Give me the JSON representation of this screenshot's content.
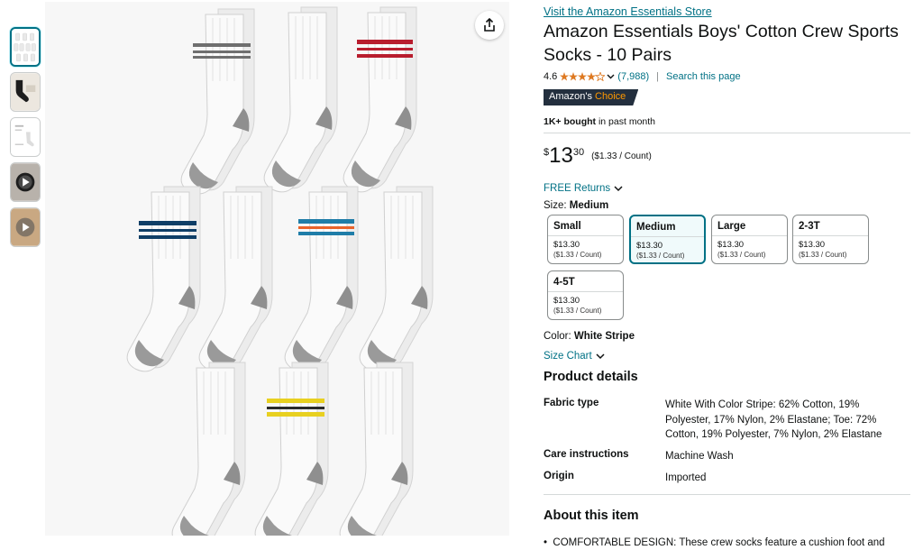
{
  "store_link": "Visit the Amazon Essentials Store",
  "title": "Amazon Essentials Boys' Cotton Crew Sports Socks - 10 Pairs",
  "rating": {
    "value": "4.6",
    "stars": 4.6,
    "count": "(7,988)",
    "search_page": "Search this page"
  },
  "badge": {
    "prefix": "Amazon's",
    "suffix": "Choice"
  },
  "bought": {
    "bold": "1K+ bought",
    "rest": "in past month"
  },
  "price": {
    "symbol": "$",
    "whole": "13",
    "fraction": "30",
    "unit": "($1.33 / Count)"
  },
  "returns": "FREE Returns",
  "size": {
    "label": "Size:",
    "selected": "Medium"
  },
  "sizes": [
    {
      "name": "Small",
      "price": "$13.30",
      "unit": "($1.33 / Count)"
    },
    {
      "name": "Medium",
      "price": "$13.30",
      "unit": "($1.33 / Count)"
    },
    {
      "name": "Large",
      "price": "$13.30",
      "unit": "($1.33 / Count)"
    },
    {
      "name": "2-3T",
      "price": "$13.30",
      "unit": "($1.33 / Count)"
    },
    {
      "name": "4-5T",
      "price": "$13.30",
      "unit": "($1.33 / Count)"
    }
  ],
  "color": {
    "label": "Color:",
    "value": "White Stripe"
  },
  "size_chart": "Size Chart",
  "product_details": {
    "title": "Product details",
    "rows": [
      {
        "key": "Fabric type",
        "value": "White With Color Stripe: 62% Cotton, 19% Polyester, 17% Nylon, 2% Elastane; Toe: 72% Cotton, 19% Polyester, 7% Nylon, 2% Elastane"
      },
      {
        "key": "Care instructions",
        "value": "Machine Wash"
      },
      {
        "key": "Origin",
        "value": "Imported"
      }
    ]
  },
  "about": {
    "title": "About this item",
    "bullet_1": "COMFORTABLE DESIGN: These crew socks feature a cushion foot and"
  },
  "colors": {
    "link": "#007185",
    "star": "#de7921",
    "badge_bg": "#232f3e",
    "badge_accent": "#ff9900"
  }
}
